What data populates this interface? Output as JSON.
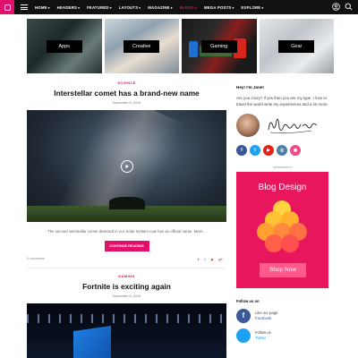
{
  "nav": {
    "items": [
      {
        "label": "HOME",
        "chevron": true,
        "active": false
      },
      {
        "label": "HEADERS",
        "chevron": true,
        "active": false
      },
      {
        "label": "FEATURED",
        "chevron": true,
        "active": false
      },
      {
        "label": "LAYOUTS",
        "chevron": true,
        "active": false
      },
      {
        "label": "MAGAZINE",
        "chevron": true,
        "active": false
      },
      {
        "label": "BLOGS",
        "chevron": true,
        "active": true
      },
      {
        "label": "MEGA POSTS",
        "chevron": true,
        "active": false
      },
      {
        "label": "EXPLORE",
        "chevron": true,
        "active": false
      }
    ],
    "icons": [
      "logo-icon",
      "hamburger-icon",
      "user-icon",
      "search-icon"
    ]
  },
  "tiles": [
    {
      "label": "Apps"
    },
    {
      "label": "Creative"
    },
    {
      "label": "Gaming"
    },
    {
      "label": "Gear"
    }
  ],
  "post1": {
    "category": "SCIENCE",
    "title": "Interstellar comet has a brand-new name",
    "date": "November 6, 2019",
    "excerpt": "The second interstellar comet detected in our Solar System now has an official name. Meet...",
    "button": "CONTINUE READING",
    "comments": "0 comments",
    "shares": [
      "f",
      "t",
      "p",
      "g+"
    ]
  },
  "post2": {
    "category": "GAMING",
    "title": "Fortnite is exciting again",
    "date": "November 6, 2019"
  },
  "sidebar": {
    "greeting": "Hey! I'm Jane!",
    "about": "Are you crazy? If yes then you are my type. I love to travel the world write my experiences and a lot more.",
    "signature": "Michael",
    "social": [
      {
        "icon": "facebook-icon",
        "glyph": "f",
        "color": "#3b5998"
      },
      {
        "icon": "twitter-icon",
        "glyph": "t",
        "color": "#1da1f2"
      },
      {
        "icon": "youtube-icon",
        "glyph": "▶",
        "color": "#e62117"
      },
      {
        "icon": "instagram-icon",
        "glyph": "◎",
        "color": "#4f7fa8"
      },
      {
        "icon": "dribbble-icon",
        "glyph": "◉",
        "color": "#ea4c89"
      }
    ],
    "ad_label": "- Advertisement -",
    "ad_title": "Blog Design",
    "ad_button": "Shop Now",
    "follow_heading": "Follow us on",
    "facebook": {
      "line1": "Like our page",
      "line2": "Facebook"
    },
    "twitter": {
      "line1": "Follow us",
      "line2": "Twitter"
    }
  },
  "colors": {
    "accent": "#e0116a",
    "nav_bg": "#111111",
    "ad_bg": "#e8175d"
  }
}
